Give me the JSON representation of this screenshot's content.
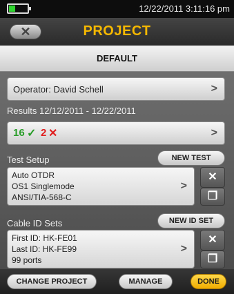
{
  "status": {
    "datetime": "12/22/2011 3:11:16 pm"
  },
  "header": {
    "title": "PROJECT",
    "subtitle": "DEFAULT",
    "back_icon": "back-arrow-icon"
  },
  "operator": {
    "label": "Operator: David Schell"
  },
  "results": {
    "label": "Results 12/12/2011 - 12/22/2011",
    "pass_count": "16",
    "fail_count": "2",
    "pass_symbol": "✓",
    "fail_symbol": "✕",
    "pass_color": "#2a9d2a",
    "fail_color": "#e02020"
  },
  "test_setup": {
    "label": "Test Setup",
    "new_button": "NEW TEST",
    "lines": [
      "Auto OTDR",
      "OS1 Singlemode",
      "ANSI/TIA-568-C"
    ]
  },
  "cable_id_sets": {
    "label": "Cable ID Sets",
    "new_button": "NEW ID SET",
    "lines": [
      "First ID: HK-FE01",
      "Last ID: HK-FE99",
      "99 ports"
    ]
  },
  "footer": {
    "change_project": "CHANGE PROJECT",
    "manage": "MANAGE",
    "done": "DONE",
    "done_color": "#f5b800"
  }
}
